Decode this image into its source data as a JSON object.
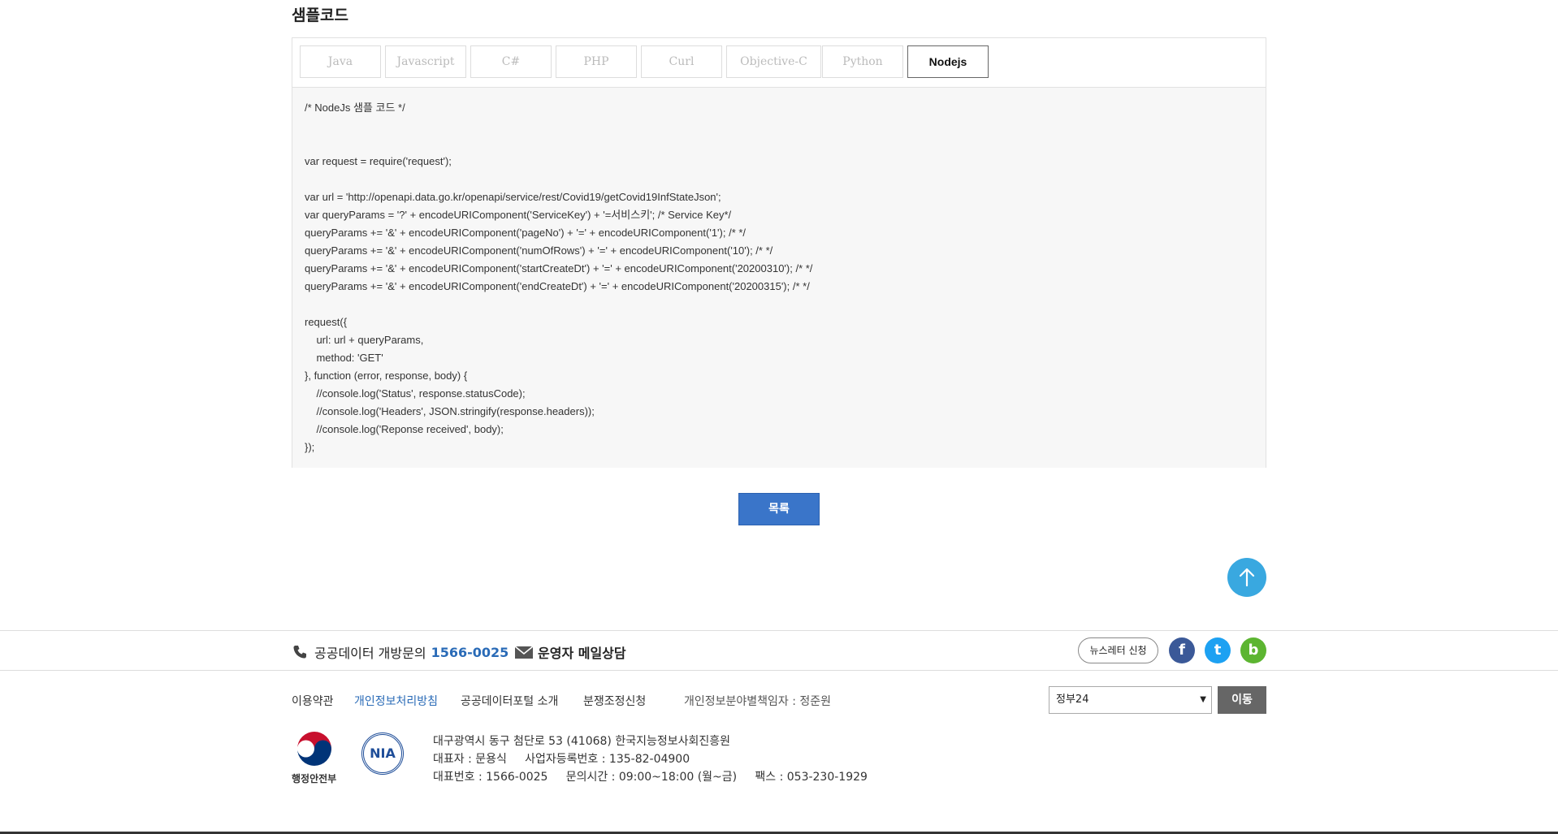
{
  "section_title": "샘플코드",
  "tabs": [
    {
      "label": "Java"
    },
    {
      "label": "Javascript"
    },
    {
      "label": "C#"
    },
    {
      "label": "PHP"
    },
    {
      "label": "Curl"
    },
    {
      "label": "Objective-C"
    },
    {
      "label": "Python"
    },
    {
      "label": "Nodejs",
      "active": true
    }
  ],
  "code_lines": [
    "/* NodeJs 샘플 코드 */",
    "",
    "",
    "var request = require('request');",
    "",
    "var url = 'http://openapi.data.go.kr/openapi/service/rest/Covid19/getCovid19InfStateJson';",
    "var queryParams = '?' + encodeURIComponent('ServiceKey') + '=서비스키'; /* Service Key*/",
    "queryParams += '&' + encodeURIComponent('pageNo') + '=' + encodeURIComponent('1'); /* */",
    "queryParams += '&' + encodeURIComponent('numOfRows') + '=' + encodeURIComponent('10'); /* */",
    "queryParams += '&' + encodeURIComponent('startCreateDt') + '=' + encodeURIComponent('20200310'); /* */",
    "queryParams += '&' + encodeURIComponent('endCreateDt') + '=' + encodeURIComponent('20200315'); /* */",
    "",
    "request({",
    "    url: url + queryParams,",
    "    method: 'GET'",
    "}, function (error, response, body) {",
    "    //console.log('Status', response.statusCode);",
    "    //console.log('Headers', JSON.stringify(response.headers));",
    "    //console.log('Reponse received', body);",
    "});"
  ],
  "list_button_label": "목록",
  "footer": {
    "contact_label": "공공데이터 개방문의",
    "contact_number": "1566-0025",
    "email_label": "운영자 메일상담",
    "newsletter_label": "뉴스레터 신청",
    "sns": [
      {
        "icon": "facebook-icon",
        "glyph": "f",
        "color": "#3b5998"
      },
      {
        "icon": "twitter-icon",
        "glyph": "t",
        "color": "#1da1f2"
      },
      {
        "icon": "band-icon",
        "glyph": "b",
        "color": "#5cb531"
      }
    ],
    "links": [
      "이용약관",
      "개인정보처리방침",
      "공공데이터포털 소개",
      "분쟁조정신청"
    ],
    "privacy_officer": "개인정보분야별책임자 : 정준원",
    "site_select_value": "정부24",
    "go_label": "이동",
    "address_lines": [
      "대구광역시 동구 첨단로 53 (41068) 한국지능정보사회진흥원",
      "대표자 : 문용식     사업자등록번호 : 135-82-04900",
      "대표번호 : 1566-0025     문의시간 : 09:00~18:00 (월~금)     팩스 : 053-230-1929"
    ],
    "mois_logo_text": "행정안전부",
    "nia_logo_text": "NIA"
  }
}
